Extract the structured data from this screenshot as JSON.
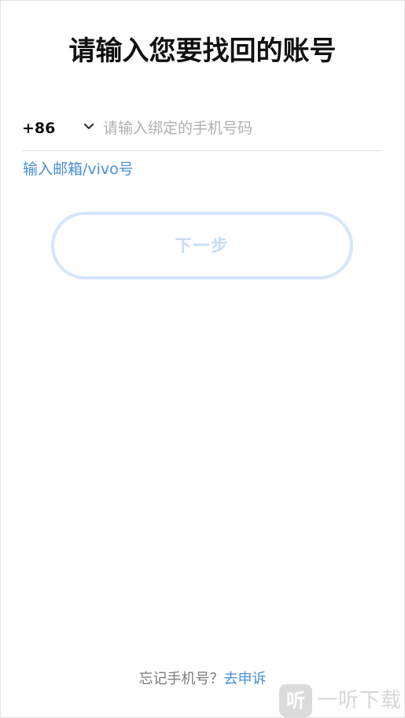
{
  "page": {
    "title": "请输入您要找回的账号"
  },
  "phone": {
    "country_code": "+86",
    "dropdown_icon": "chevron-down-icon",
    "placeholder": "请输入绑定的手机号码",
    "value": ""
  },
  "alt_link": {
    "label": "输入邮箱/vivo号"
  },
  "next_button": {
    "label": "下一步",
    "enabled": false
  },
  "footer": {
    "question": "忘记手机号？",
    "appeal_label": "去申诉"
  },
  "watermark": {
    "icon_char": "听",
    "text": "一听下载"
  },
  "colors": {
    "link": "#4a8fd9",
    "button_border_disabled": "#d6e6fb",
    "button_text_disabled": "#c5dbf5",
    "divider": "#dedede",
    "placeholder": "#b0b0b0"
  }
}
